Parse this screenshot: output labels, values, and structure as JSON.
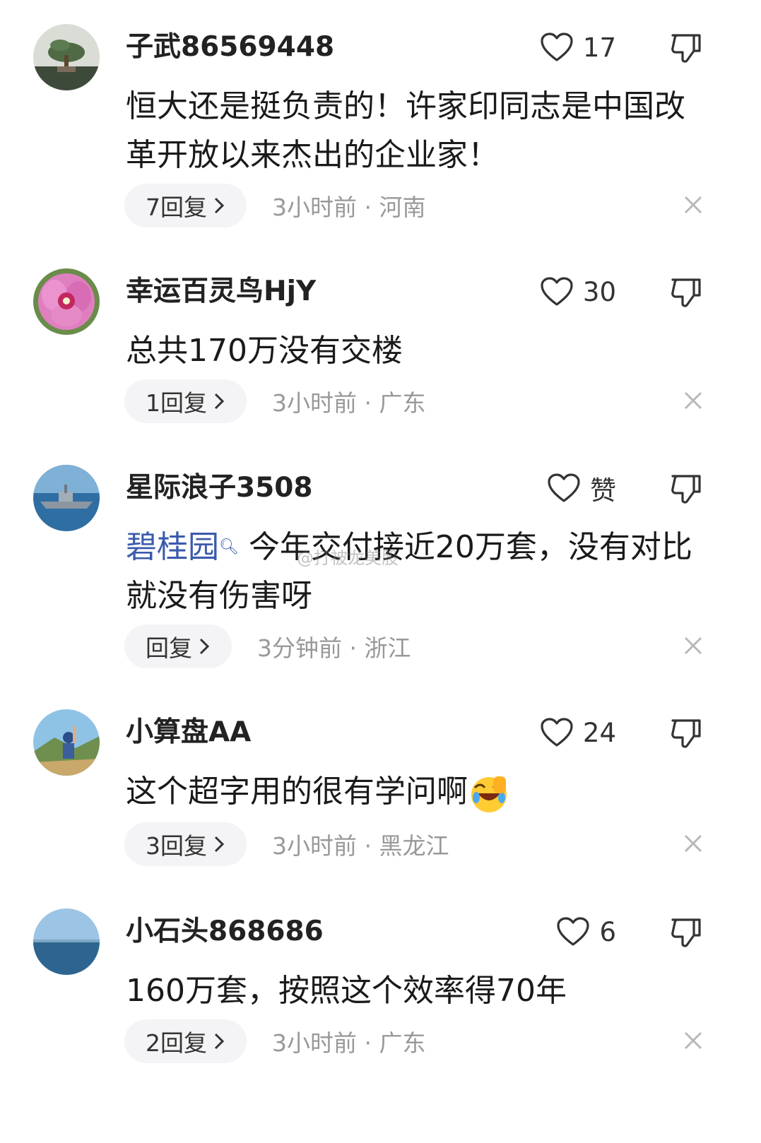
{
  "comments": [
    {
      "username": "子武86569448",
      "likes": "17",
      "text": "恒大还是挺负责的！许家印同志是中国改革开放以来杰出的企业家！",
      "reply_label": "7回复",
      "time_loc": "3小时前 · 河南",
      "avatar_icon": "bonsai-avatar"
    },
    {
      "username": "幸运百灵鸟HjY",
      "likes": "30",
      "text": "总共170万没有交楼",
      "reply_label": "1回复",
      "time_loc": "3小时前 · 广东",
      "avatar_icon": "flower-avatar"
    },
    {
      "username": "星际浪子3508",
      "likes": "赞",
      "link_text": "碧桂园",
      "text": "今年交付接近20万套，没有对比就没有伤害呀",
      "reply_label": "回复",
      "time_loc": "3分钟前 · 浙江",
      "avatar_icon": "warship-avatar"
    },
    {
      "username": "小算盘AA",
      "likes": "24",
      "text": "这个超字用的很有学问啊",
      "reply_label": "3回复",
      "time_loc": "3小时前 · 黑龙江",
      "avatar_icon": "waving-person-avatar",
      "emoji": "laughing-crying-emoji"
    },
    {
      "username": "小石头868686",
      "likes": "6",
      "text": "160万套，按照这个效率得70年",
      "reply_label": "2回复",
      "time_loc": "3小时前 · 广东",
      "avatar_icon": "sea-avatar"
    }
  ],
  "watermark": "@打被龙美股",
  "colors": {
    "link": "#3b5bab",
    "meta_text": "#999999",
    "reply_bg": "#f4f4f6"
  }
}
